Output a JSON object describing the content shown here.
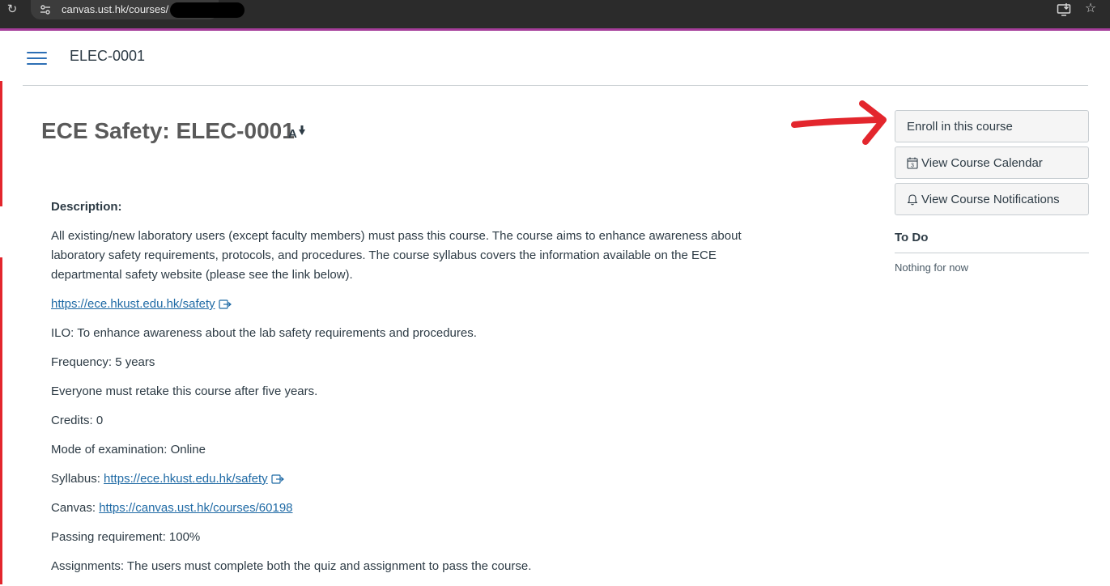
{
  "browser": {
    "url": "canvas.ust.hk/courses/",
    "icons": [
      "reload-icon",
      "site-settings-icon",
      "install-app-icon",
      "bookmark-star-icon"
    ]
  },
  "header": {
    "course_code": "ELEC-0001"
  },
  "page": {
    "title": "ECE Safety: ELEC-0001"
  },
  "content": {
    "description_label": "Description:",
    "description_text": "All existing/new laboratory users (except faculty members) must pass this course. The course aims to enhance awareness about laboratory safety requirements, protocols, and procedures. The course syllabus covers the information available on the ECE departmental safety website (please see the link below).",
    "safety_link": "https://ece.hkust.edu.hk/safety",
    "ilo": "ILO: To enhance awareness about the lab safety requirements and procedures.",
    "frequency": "Frequency: 5 years",
    "retake": "Everyone must retake this course after five years.",
    "credits": "Credits: 0",
    "exam_mode": "Mode of examination: Online",
    "syllabus_label": "Syllabus: ",
    "syllabus_link": "https://ece.hkust.edu.hk/safety",
    "canvas_label": "Canvas: ",
    "canvas_link": "https://canvas.ust.hk/courses/60198",
    "passing": "Passing requirement: 100%",
    "assignments": "Assignments: The users must complete both the quiz and assignment to pass the course."
  },
  "sidebar": {
    "enroll_label": "Enroll in this course",
    "calendar_label": "View Course Calendar",
    "notifications_label": "View Course Notifications",
    "todo_title": "To Do",
    "todo_empty": "Nothing for now"
  },
  "colors": {
    "link": "#1f6aa5",
    "hamburger": "#2d6fb5",
    "annotation": "#e3262d",
    "browser_accent": "#a53d9a"
  }
}
